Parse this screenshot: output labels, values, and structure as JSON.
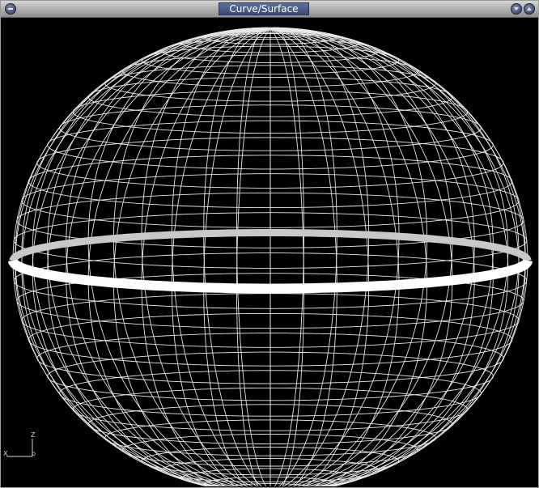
{
  "window": {
    "title": "Curve/Surface",
    "buttons": {
      "left": "window-menu",
      "right": [
        "minimize",
        "maximize"
      ]
    }
  },
  "viewport": {
    "background": "#000000",
    "wire_color": "#e8e8e8",
    "ring_color": "#ffffff",
    "axes": {
      "z_label": "Z",
      "x_label": "X",
      "y_label": "b"
    }
  }
}
